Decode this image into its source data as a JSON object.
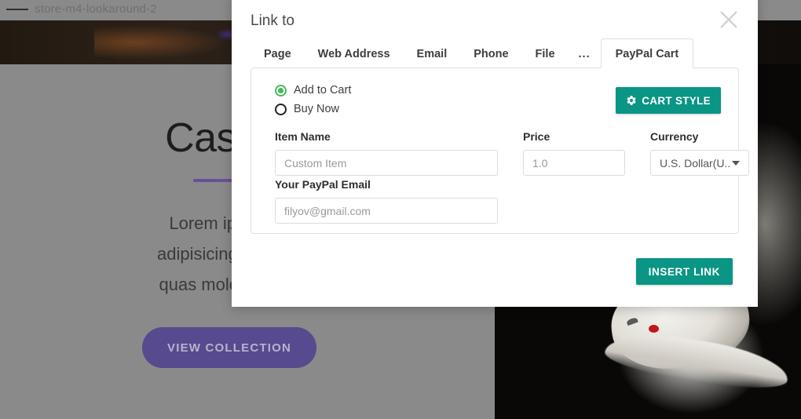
{
  "background": {
    "browser_tab_title": "store-m4-lookaround-2",
    "hero_heading": "Casual C",
    "hero_paragraph": "Lorem ipsum dolor s\nadipisicing elit. Quos ali\nquas molestiae placeat",
    "cta_label": "VIEW COLLECTION"
  },
  "modal": {
    "title": "Link to",
    "close_icon": "close-icon",
    "tabs": [
      {
        "label": "Page",
        "active": false
      },
      {
        "label": "Web Address",
        "active": false
      },
      {
        "label": "Email",
        "active": false
      },
      {
        "label": "Phone",
        "active": false
      },
      {
        "label": "File",
        "active": false
      },
      {
        "label": "...",
        "active": false
      },
      {
        "label": "PayPal Cart",
        "active": true
      }
    ],
    "paypal_cart": {
      "mode_options": [
        {
          "label": "Add to Cart",
          "selected": true
        },
        {
          "label": "Buy Now",
          "selected": false
        }
      ],
      "cart_style_button": {
        "label": "CART STYLE",
        "icon": "gear-icon"
      },
      "fields": {
        "item_name": {
          "label": "Item Name",
          "value": "",
          "placeholder": "Custom Item"
        },
        "price": {
          "label": "Price",
          "value": "",
          "placeholder": "1.0"
        },
        "currency": {
          "label": "Currency",
          "selected": "U.S. Dollar(U.."
        },
        "paypal_email": {
          "label": "Your PayPal Email",
          "value": "",
          "placeholder": "filyov@gmail.com"
        }
      }
    },
    "insert_button_label": "INSERT LINK"
  },
  "colors": {
    "accent_teal": "#0a9585",
    "radio_green": "#46b95c",
    "cta_purple": "#574a8e",
    "rule_purple": "#6a4e9c"
  }
}
